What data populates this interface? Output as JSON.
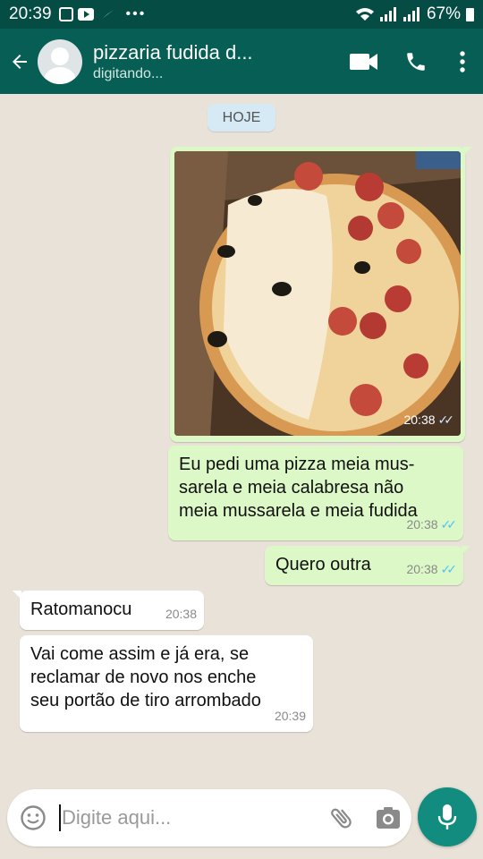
{
  "status_bar": {
    "time": "20:39",
    "battery": "67%"
  },
  "header": {
    "title": "pizzaria fudida d...",
    "subtitle": "digitando..."
  },
  "chat": {
    "day_label": "HOJE",
    "messages": [
      {
        "type": "image",
        "direction": "out",
        "time": "20:38"
      },
      {
        "type": "text",
        "direction": "out",
        "lines": [
          "Eu pedi uma pizza meia mus-",
          "sarela e meia calabresa não",
          "meia mussarela e meia fudida"
        ],
        "time": "20:38"
      },
      {
        "type": "text",
        "direction": "out",
        "text": "Quero outra",
        "time": "20:38"
      },
      {
        "type": "text",
        "direction": "in",
        "text": "Ratomanocu",
        "time": "20:38"
      },
      {
        "type": "text",
        "direction": "in",
        "lines": [
          "Vai come assim e já era, se",
          "reclamar de novo nos enche",
          "seu portão de tiro arrombado"
        ],
        "time": "20:39"
      }
    ]
  },
  "input": {
    "placeholder": "Digite aqui..."
  },
  "icons": {
    "back": "arrow-left-icon",
    "video": "video-call-icon",
    "call": "phone-icon",
    "menu": "more-vertical-icon",
    "emoji": "emoji-icon",
    "attach": "paperclip-icon",
    "camera": "camera-icon",
    "mic": "mic-icon"
  },
  "colors": {
    "header": "#075e54",
    "outgoing_bubble": "#dcf8c6",
    "incoming_bubble": "#ffffff",
    "read_ticks": "#4fc3f7",
    "mic_button": "#128c7e"
  }
}
